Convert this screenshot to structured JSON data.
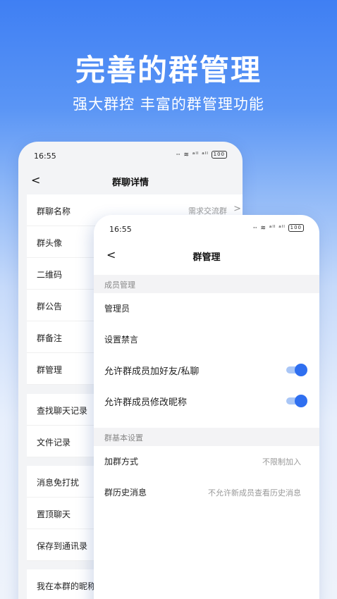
{
  "hero": {
    "title": "完善的群管理",
    "subtitle": "强大群控 丰富的群管理功能"
  },
  "back_screen": {
    "status": {
      "time": "16:55",
      "signal_icons": "ⵈ ≋ ᵃˡˡ ᵃˡˡ",
      "battery": "100"
    },
    "nav": {
      "back": "<",
      "title": "群聊详情"
    },
    "group1": [
      {
        "label": "群聊名称",
        "value": "需求交流群",
        "chevron": ">"
      },
      {
        "label": "群头像"
      },
      {
        "label": "二维码"
      },
      {
        "label": "群公告"
      },
      {
        "label": "群备注"
      },
      {
        "label": "群管理"
      }
    ],
    "group2": [
      {
        "label": "查找聊天记录"
      },
      {
        "label": "文件记录"
      }
    ],
    "group3": [
      {
        "label": "消息免打扰"
      },
      {
        "label": "置顶聊天"
      },
      {
        "label": "保存到通讯录"
      }
    ],
    "group4": [
      {
        "label": "我在本群的昵称"
      }
    ]
  },
  "front_screen": {
    "status": {
      "time": "16:55",
      "signal_icons": "ⵈ ≋ ᵃˡˡ ᵃˡˡ",
      "battery": "100"
    },
    "nav": {
      "back": "<",
      "title": "群管理"
    },
    "section_member": "成员管理",
    "member_rows": [
      {
        "label": "管理员"
      },
      {
        "label": "设置禁言"
      },
      {
        "label": "允许群成员加好友/私聊",
        "toggle": true
      },
      {
        "label": "允许群成员修改昵称",
        "toggle": true
      }
    ],
    "section_basic": "群基本设置",
    "basic_rows": [
      {
        "label": "加群方式",
        "value": "不限制加入"
      },
      {
        "label": "群历史消息",
        "value": "不允许新成员查看历史消息"
      }
    ]
  },
  "colors": {
    "accent": "#2f6ff0",
    "toggle_track": "#a9c6f6",
    "background_top": "#3f7ff3"
  }
}
